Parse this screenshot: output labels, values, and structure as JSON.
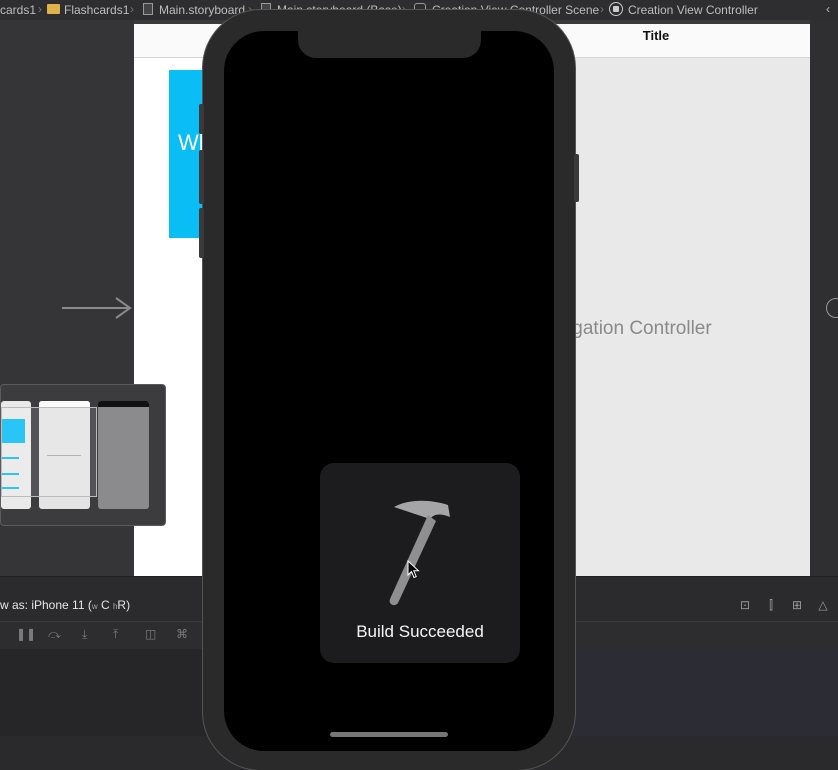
{
  "breadcrumb": {
    "items": [
      "cards1",
      "Flashcards1",
      "Main.storyboard",
      "Main.storyboard (Base)",
      "Creation View Controller Scene",
      "Creation View Controller"
    ]
  },
  "canvas": {
    "nav_title": "Title",
    "placeholder_label": "avigation Controller",
    "cyan_card_text": "Wh"
  },
  "device_bar": {
    "view_as_prefix": "w as: iPhone 11 (",
    "view_as_w": "w",
    "view_as_c": "C",
    "view_as_h": "h",
    "view_as_r": "R",
    "view_as_suffix": ")"
  },
  "hud": {
    "message": "Build Succeeded",
    "icon": "hammer-icon"
  },
  "colors": {
    "accent_cyan": "#0bbdf5",
    "hud_background": "#1c1c1e"
  }
}
